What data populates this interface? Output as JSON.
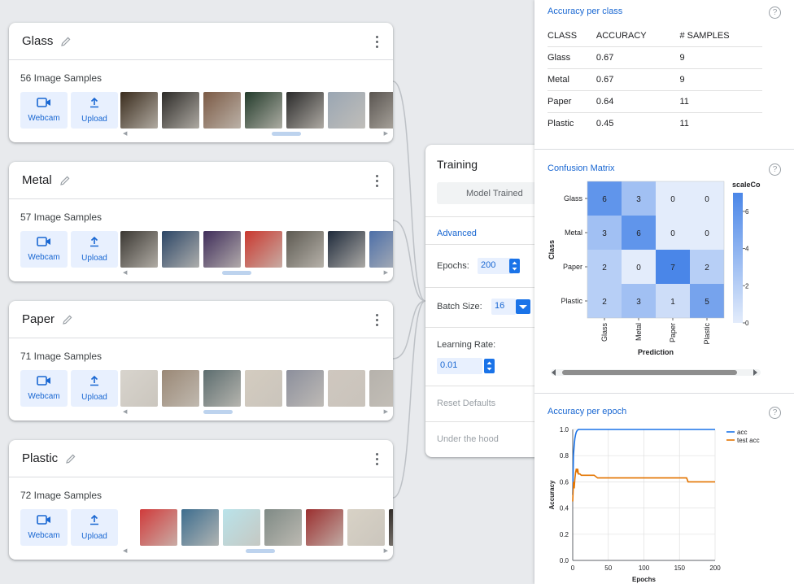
{
  "classes": [
    {
      "name": "Glass",
      "samples": "56 Image Samples",
      "webcam": "Webcam",
      "upload": "Upload",
      "thumbs": [
        "#3a2c1d",
        "#2d2b28",
        "#7b5a45",
        "#233b2b",
        "#2a2a2a",
        "#9aa6b3",
        "#5a5550",
        "#b9b4ae",
        "#413a31"
      ],
      "scroll": 0.63
    },
    {
      "name": "Metal",
      "samples": "57 Image Samples",
      "webcam": "Webcam",
      "upload": "Upload",
      "thumbs": [
        "#3b3833",
        "#2c4666",
        "#3f2d5a",
        "#c9382f",
        "#5d5a52",
        "#1e2a3b",
        "#4d6fa8",
        "#b9a99a",
        "#55504a"
      ],
      "scroll": 0.42
    },
    {
      "name": "Paper",
      "samples": "71 Image Samples",
      "webcam": "Webcam",
      "upload": "Upload",
      "thumbs": [
        "#d8d4cd",
        "#9a8876",
        "#5c6d6f",
        "#d4ccc0",
        "#8c8f9c",
        "#cfc7bf",
        "#b6b2ac"
      ],
      "scroll": 0.34
    },
    {
      "name": "Plastic",
      "samples": "72 Image Samples",
      "webcam": "Webcam",
      "upload": "Upload",
      "thumbs": [
        "#d03b3b",
        "#3d6d8e",
        "#b9e3ea",
        "#7f8a85",
        "#9b2f2f",
        "#d8d2c6",
        "#2f2a26"
      ],
      "scroll": 0.52
    }
  ],
  "training": {
    "title": "Training",
    "model_button": "Model Trained",
    "advanced": "Advanced",
    "epochs_label": "Epochs:",
    "epochs_value": "200",
    "batch_label": "Batch Size:",
    "batch_value": "16",
    "lr_label": "Learning Rate:",
    "lr_value": "0.01",
    "reset": "Reset Defaults",
    "under_hood": "Under the hood"
  },
  "accuracy_per_class": {
    "title": "Accuracy per class",
    "help": "?",
    "headers": [
      "CLASS",
      "ACCURACY",
      "# SAMPLES"
    ],
    "rows": [
      [
        "Glass",
        "0.67",
        "9"
      ],
      [
        "Metal",
        "0.67",
        "9"
      ],
      [
        "Paper",
        "0.64",
        "11"
      ],
      [
        "Plastic",
        "0.45",
        "11"
      ]
    ]
  },
  "confusion_matrix": {
    "title": "Confusion Matrix",
    "help": "?",
    "labels": [
      "Glass",
      "Metal",
      "Paper",
      "Plastic"
    ],
    "matrix": [
      [
        6,
        3,
        0,
        0
      ],
      [
        3,
        6,
        0,
        0
      ],
      [
        2,
        0,
        7,
        2
      ],
      [
        2,
        3,
        1,
        5
      ]
    ],
    "ylabel": "Class",
    "xlabel": "Prediction",
    "scale_label": "scaleCo",
    "scale_ticks": [
      "6",
      "4",
      "2",
      "0"
    ],
    "colors": {
      "low": "#e3ecfb",
      "high": "#4a86e8"
    }
  },
  "accuracy_per_epoch": {
    "title": "Accuracy per epoch",
    "help": "?",
    "xlabel": "Epochs",
    "ylabel": "Accuracy",
    "yticks": [
      "1.0",
      "0.8",
      "0.6",
      "0.4",
      "0.2",
      "0.0"
    ],
    "xticks": [
      "0",
      "50",
      "100",
      "150",
      "200"
    ],
    "legend": [
      "acc",
      "test acc"
    ]
  },
  "chart_data": {
    "type": "line",
    "xlabel": "Epochs",
    "ylabel": "Accuracy",
    "xlim": [
      0,
      200
    ],
    "ylim": [
      0,
      1.0
    ],
    "series": [
      {
        "name": "acc",
        "color": "#1a73e8",
        "x": [
          0,
          1,
          2,
          3,
          4,
          5,
          6,
          8,
          10,
          20,
          50,
          100,
          150,
          200
        ],
        "y": [
          0.5,
          0.8,
          0.88,
          0.93,
          0.96,
          0.98,
          0.99,
          1.0,
          1.0,
          1.0,
          1.0,
          1.0,
          1.0,
          1.0
        ]
      },
      {
        "name": "test acc",
        "color": "#e37400",
        "x": [
          0,
          1,
          2,
          3,
          4,
          5,
          6,
          7,
          8,
          10,
          12,
          15,
          20,
          30,
          35,
          50,
          100,
          160,
          162,
          200
        ],
        "y": [
          0.45,
          0.6,
          0.55,
          0.62,
          0.67,
          0.7,
          0.68,
          0.7,
          0.66,
          0.66,
          0.65,
          0.65,
          0.65,
          0.65,
          0.63,
          0.63,
          0.63,
          0.63,
          0.6,
          0.6
        ]
      }
    ]
  }
}
